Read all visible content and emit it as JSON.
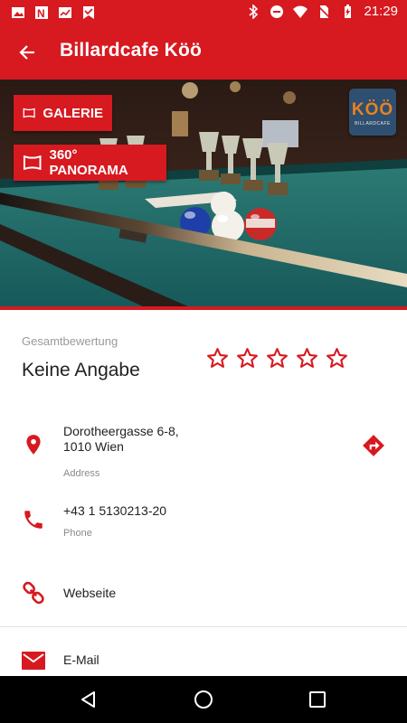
{
  "status_bar": {
    "time": "21:29",
    "left_icons": [
      "image-icon",
      "news-icon",
      "signal-icon",
      "check-bookmark-icon"
    ],
    "right_icons": [
      "bluetooth-icon",
      "do-not-disturb-icon",
      "wifi-icon",
      "no-sim-icon",
      "battery-icon"
    ]
  },
  "app_bar": {
    "title": "Billardcafe Köö",
    "back_icon": "arrow-back-icon"
  },
  "hero": {
    "gallery_label": "GALERIE",
    "panorama_label": "360° PANORAMA",
    "logo_text": "KÖÖ",
    "logo_subtext": "BILLARDCAFE"
  },
  "rating": {
    "label": "Gesamtbewertung",
    "value": "Keine Angabe",
    "stars_total": 5,
    "stars_filled": 0
  },
  "contact": {
    "address_line1": "Dorotheergasse 6-8,",
    "address_line2": "1010 Wien",
    "address_label": "Address",
    "phone": "+43 1 5130213-20",
    "phone_label": "Phone",
    "website": "Webseite",
    "email": "E-Mail"
  },
  "colors": {
    "accent": "#d71920",
    "felt": "#1f6b66"
  },
  "nav_bar": [
    "back-triangle-icon",
    "home-circle-icon",
    "recents-square-icon"
  ]
}
